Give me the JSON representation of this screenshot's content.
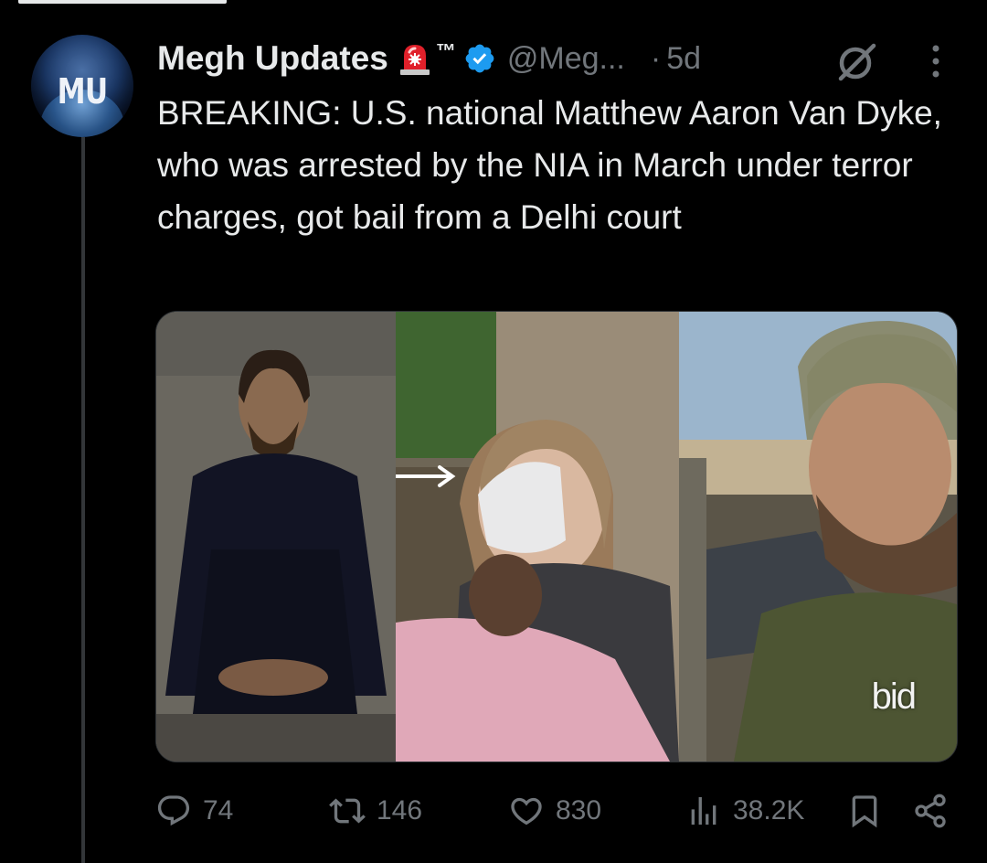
{
  "tweet": {
    "author": {
      "avatar_initials": "MU",
      "display_name": "Megh Updates",
      "trademark": "™",
      "handle": "@Meg...",
      "separator": "·",
      "timestamp": "5d"
    },
    "text": "BREAKING: U.S. national Matthew Aaron Van Dyke, who was arrested by the NIA in March under terror charges, got bail from a Delhi court",
    "media": {
      "watermark": "bid"
    },
    "metrics": {
      "replies": "74",
      "reposts": "146",
      "likes": "830",
      "views": "38.2K"
    }
  },
  "icons": {
    "siren": "police-siren-emoji",
    "verified": "verified-badge",
    "grok": "grok-icon",
    "more": "more-vertical-icon",
    "reply": "reply-icon",
    "repost": "repost-icon",
    "like": "heart-icon",
    "views": "views-icon",
    "bookmark": "bookmark-icon",
    "share": "share-icon"
  },
  "colors": {
    "background": "#000000",
    "text_primary": "#e7e9ea",
    "text_secondary": "#71767b",
    "verified_blue": "#1d9bf0",
    "siren_red": "#e0202a"
  }
}
